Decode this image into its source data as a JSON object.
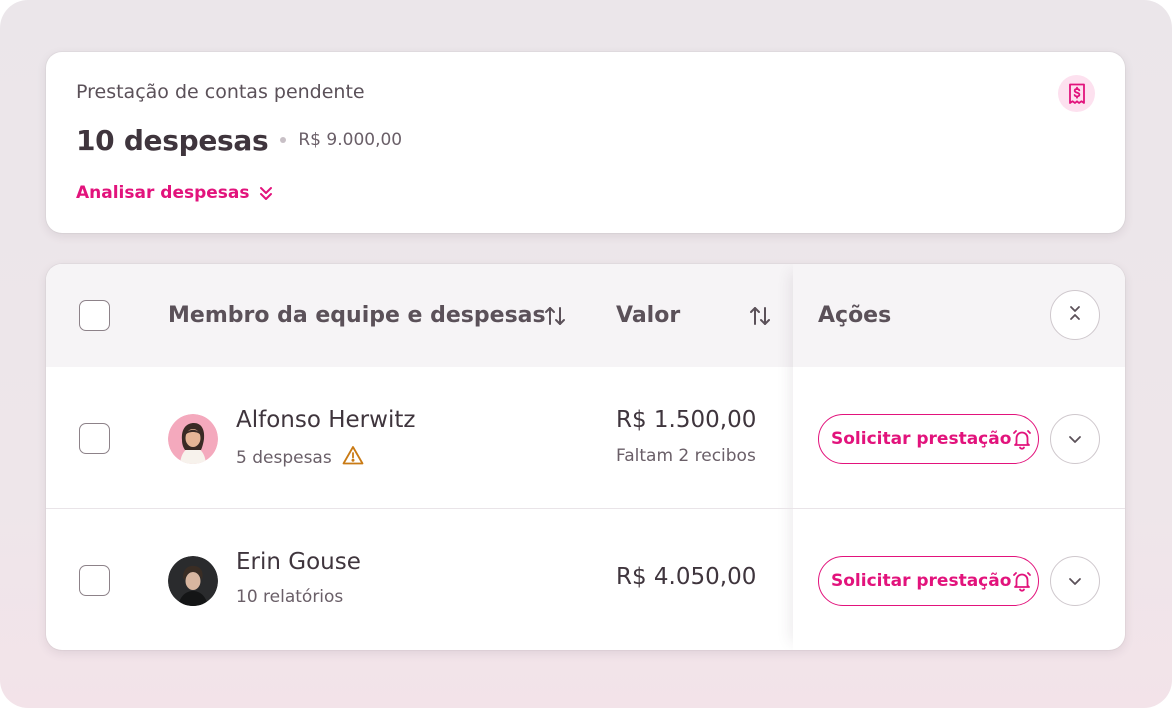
{
  "summary": {
    "title": "Prestação de contas pendente",
    "count": "10 despesas",
    "amount": "R$ 9.000,00",
    "analyze_label": "Analisar despesas",
    "badge_icon": "receipt-dollar-icon"
  },
  "table": {
    "columns": {
      "member": "Membro da equipe e despesas",
      "value": "Valor",
      "actions": "Ações"
    },
    "rows": [
      {
        "name": "Alfonso Herwitz",
        "subtitle": "5 despesas",
        "warning": true,
        "value": "R$ 1.500,00",
        "value_note": "Faltam 2 recibos",
        "action_label": "Solicitar prestação"
      },
      {
        "name": "Erin Gouse",
        "subtitle": "10 relatórios",
        "warning": false,
        "value": "R$ 4.050,00",
        "value_note": "",
        "action_label": "Solicitar prestação"
      }
    ]
  },
  "colors": {
    "accent": "#e2137c",
    "accent_soft": "#fde1ef",
    "text_primary": "#3f353d",
    "text_secondary": "#6a5f68",
    "warning": "#c97a14"
  }
}
